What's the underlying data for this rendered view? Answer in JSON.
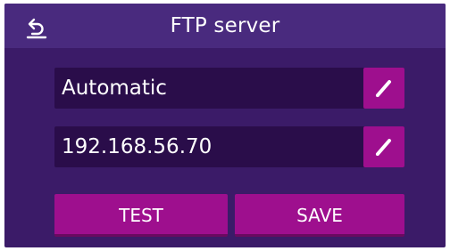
{
  "header": {
    "title": "FTP server",
    "back_icon": "back-arrow-icon"
  },
  "fields": [
    {
      "value": "Automatic",
      "edit_icon": "pencil-icon"
    },
    {
      "value": "192.168.56.70",
      "edit_icon": "pencil-icon"
    }
  ],
  "actions": {
    "test_label": "TEST",
    "save_label": "SAVE"
  },
  "colors": {
    "background": "#3b1b68",
    "header": "#492a7e",
    "field": "#2a0d4a",
    "accent": "#9e0f8e",
    "text": "#ffffff"
  }
}
